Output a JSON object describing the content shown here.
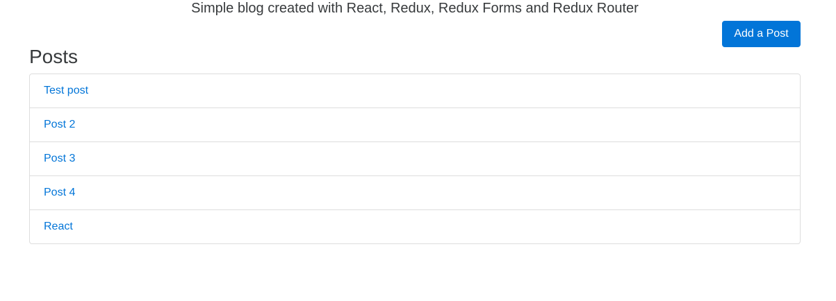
{
  "header": {
    "tagline": "Simple blog created with React, Redux, Redux Forms and Redux Router",
    "add_post_label": "Add a Post"
  },
  "main": {
    "title": "Posts",
    "posts": [
      {
        "title": "Test post"
      },
      {
        "title": "Post 2"
      },
      {
        "title": "Post 3"
      },
      {
        "title": "Post 4"
      },
      {
        "title": "React"
      }
    ]
  },
  "colors": {
    "accent": "#0275d8",
    "text": "#373a3c",
    "border": "#dddddd"
  }
}
